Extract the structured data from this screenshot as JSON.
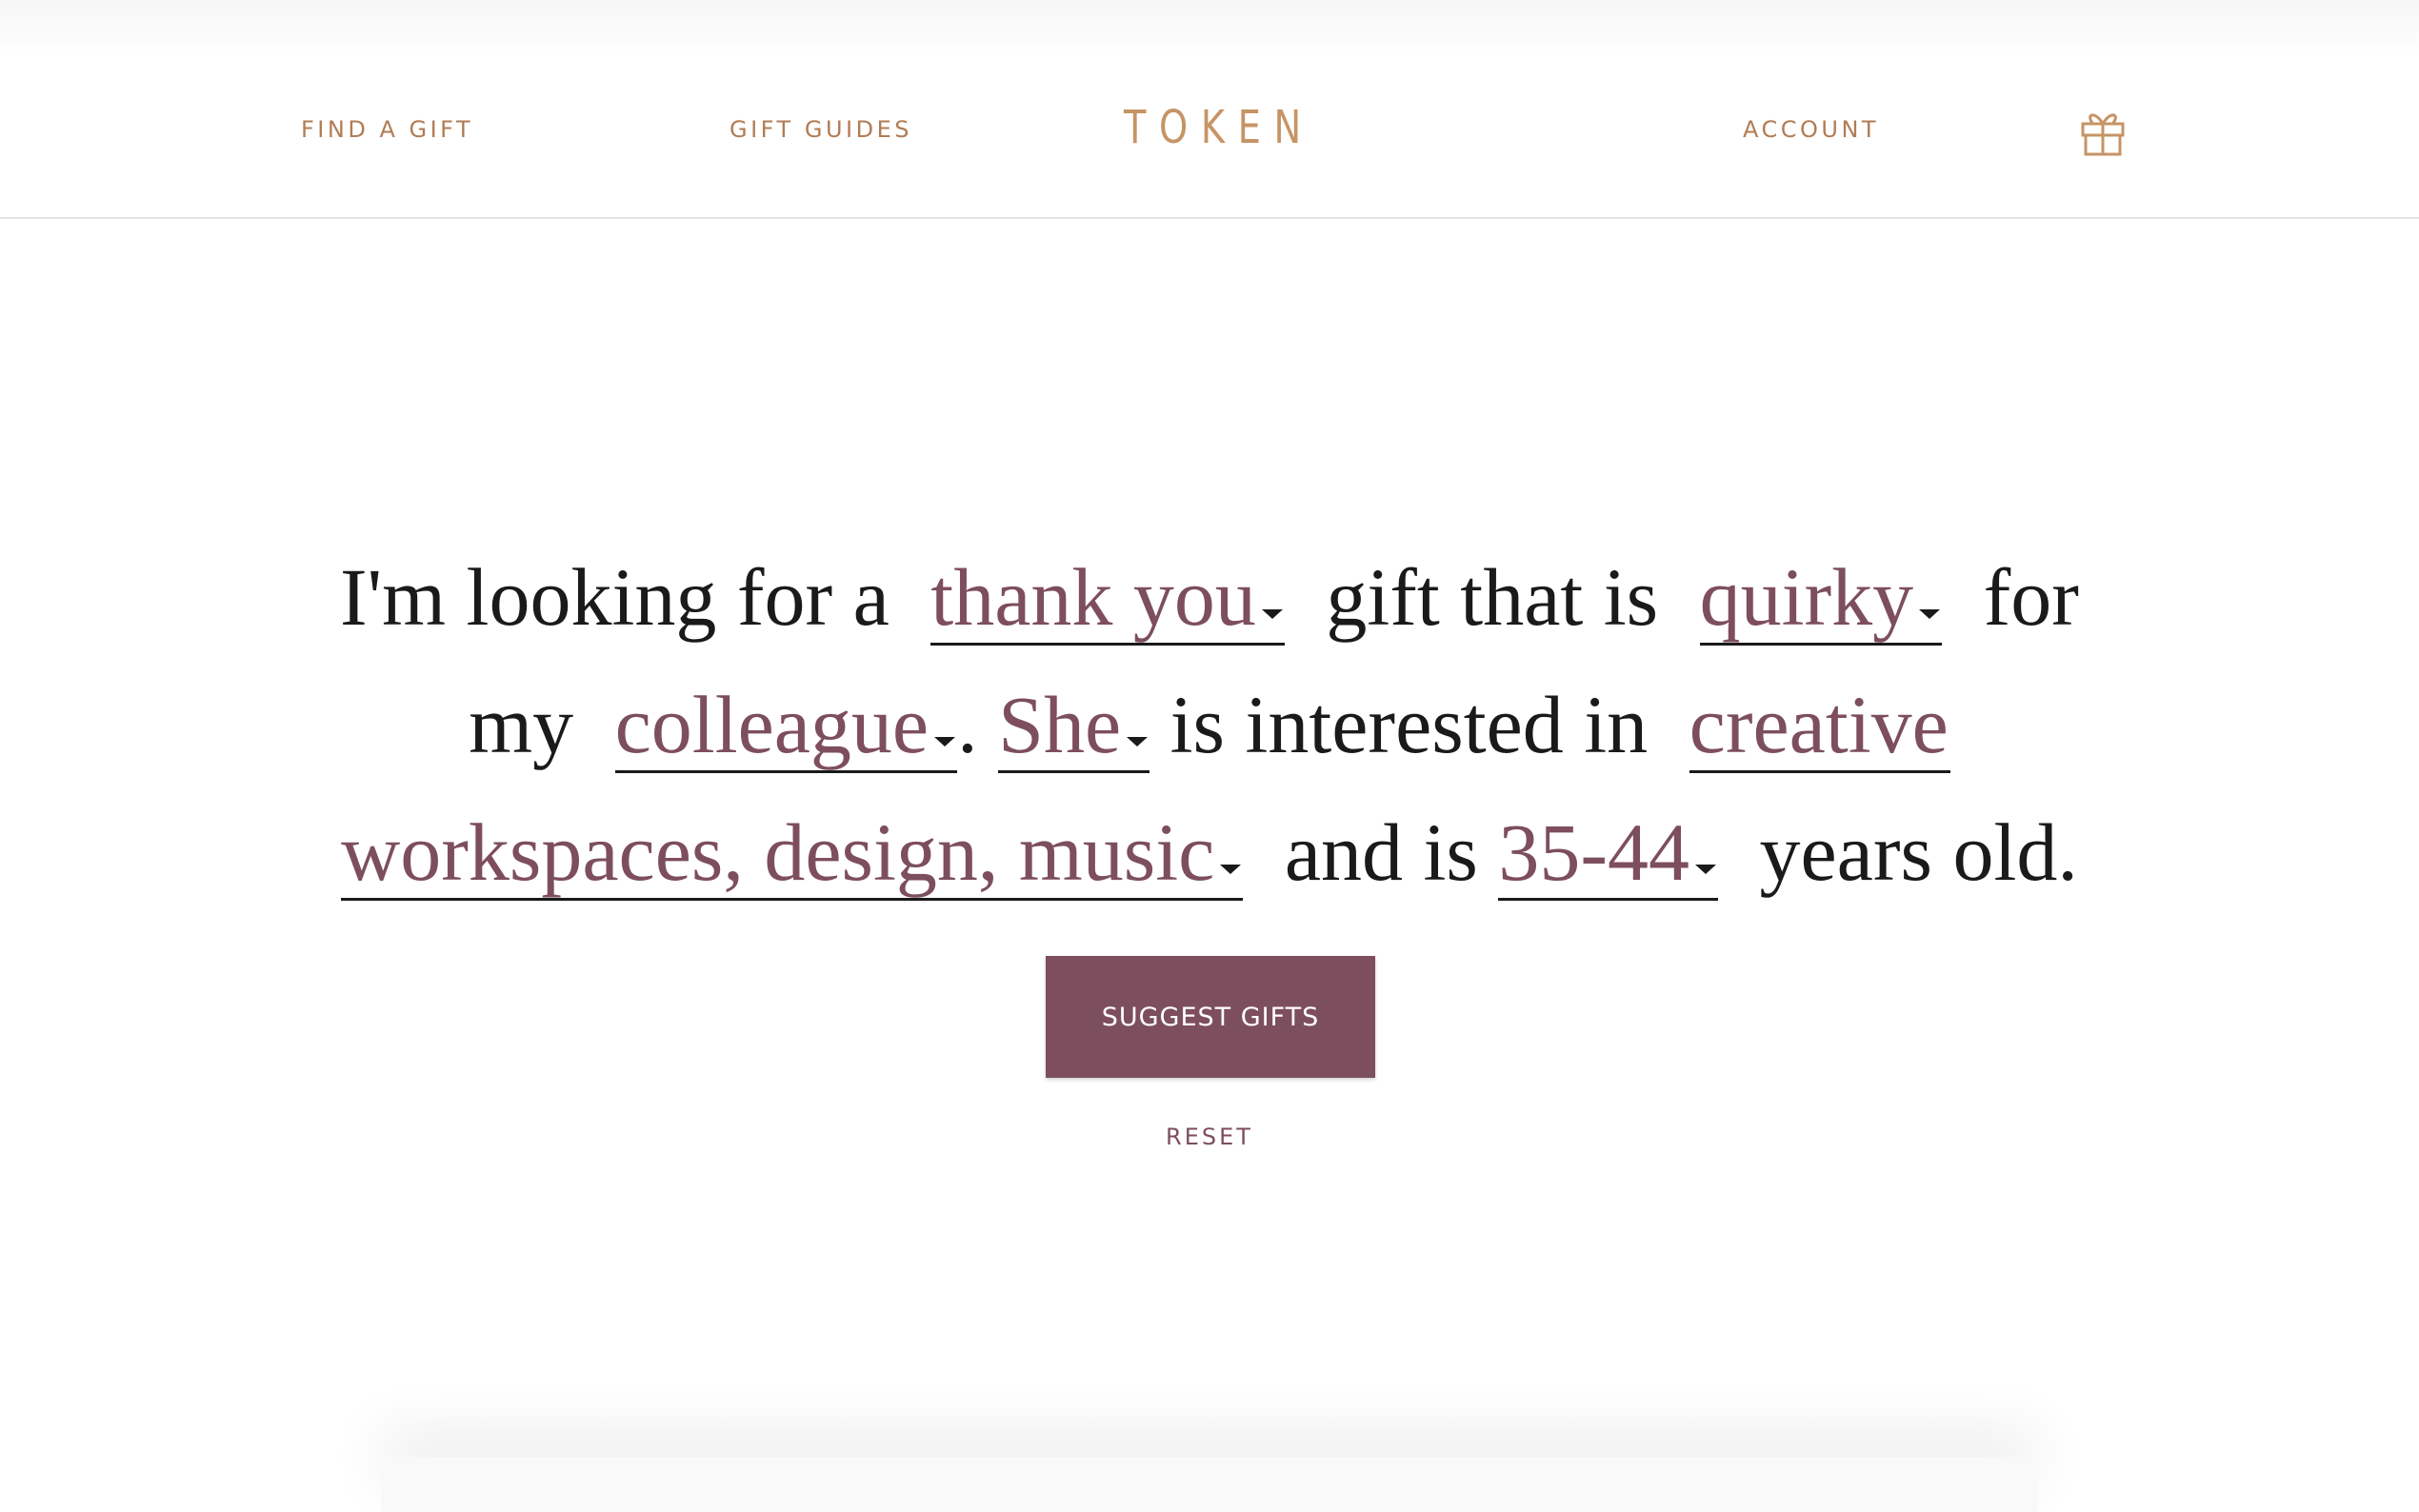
{
  "header": {
    "find_a_gift": "FIND A GIFT",
    "gift_guides": "GIFT GUIDES",
    "logo": "TOKEN",
    "account": "ACCOUNT",
    "cart_icon": "gift-box-icon"
  },
  "sentence": {
    "t1": "I'm looking for a",
    "occasion": "thank you",
    "t2": "gift that is",
    "style": "quirky",
    "t3": "for",
    "t4": "my",
    "relation": "colleague",
    "t5": ".",
    "pronoun": "She",
    "t6": "is interested in",
    "interests_line1": "creative",
    "interests_line2": "workspaces, design, music",
    "t7": "and is",
    "age": "35-44",
    "t8": "years old."
  },
  "actions": {
    "suggest": "SUGGEST GIFTS",
    "reset": "RESET"
  },
  "colors": {
    "accent": "#7d4e5e",
    "nav": "#b27c55",
    "logo": "#c69466"
  }
}
